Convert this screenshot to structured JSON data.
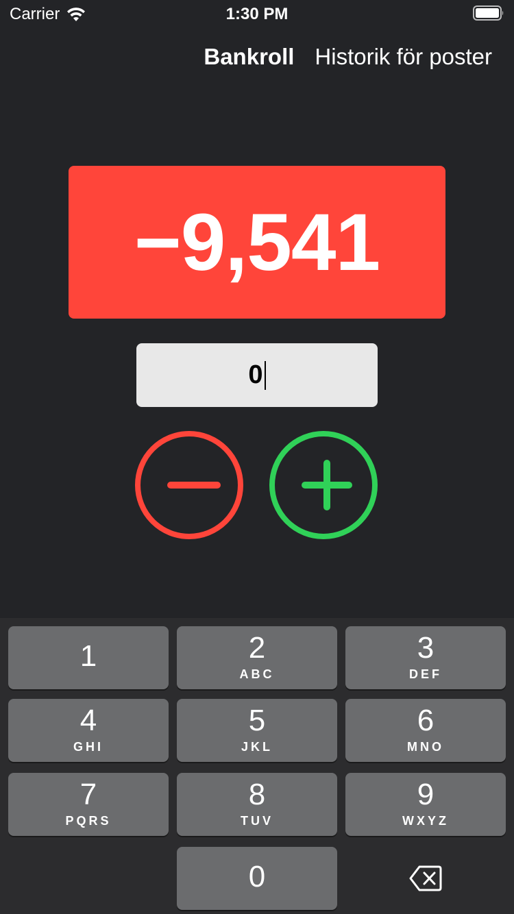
{
  "status_bar": {
    "carrier": "Carrier",
    "time": "1:30 PM"
  },
  "nav": {
    "items": [
      {
        "label": "Bankroll",
        "active": true
      },
      {
        "label": "Historik för poster",
        "active": false
      }
    ]
  },
  "balance": {
    "value": "−9,541",
    "color": "#ff453a"
  },
  "amount_input": {
    "value": "0"
  },
  "actions": {
    "minus_icon": "minus-circle-icon",
    "plus_icon": "plus-circle-icon",
    "minus_color": "#ff453a",
    "plus_color": "#30d158"
  },
  "keypad": {
    "keys": [
      {
        "digit": "1",
        "letters": ""
      },
      {
        "digit": "2",
        "letters": "ABC"
      },
      {
        "digit": "3",
        "letters": "DEF"
      },
      {
        "digit": "4",
        "letters": "GHI"
      },
      {
        "digit": "5",
        "letters": "JKL"
      },
      {
        "digit": "6",
        "letters": "MNO"
      },
      {
        "digit": "7",
        "letters": "PQRS"
      },
      {
        "digit": "8",
        "letters": "TUV"
      },
      {
        "digit": "9",
        "letters": "WXYZ"
      },
      {
        "digit": "0",
        "letters": ""
      }
    ],
    "backspace_icon": "backspace-icon"
  }
}
